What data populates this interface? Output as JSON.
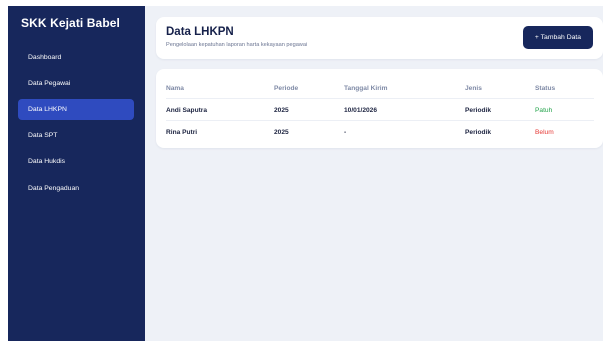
{
  "sidebar": {
    "brand": "SKK Kejati Babel",
    "items": [
      {
        "label": "Dashboard"
      },
      {
        "label": "Data Pegawai"
      },
      {
        "label": "Data LHKPN"
      },
      {
        "label": "Data SPT"
      },
      {
        "label": "Data Hukdis"
      },
      {
        "label": "Data Pengaduan"
      }
    ],
    "active_index": 2
  },
  "header": {
    "title": "Data LHKPN",
    "subtitle": "Pengelolaan kepatuhan laporan harta kekayaan pegawai",
    "add_button_label": "+ Tambah Data"
  },
  "table": {
    "columns": [
      "Nama",
      "Periode",
      "Tanggal Kirim",
      "Jenis",
      "Status"
    ],
    "rows": [
      {
        "nama": "Andi Saputra",
        "periode": "2025",
        "tanggal": "10/01/2026",
        "jenis": "Periodik",
        "status": "Patuh"
      },
      {
        "nama": "Rina Putri",
        "periode": "2025",
        "tanggal": "-",
        "jenis": "Periodik",
        "status": "Belum"
      }
    ]
  },
  "colors": {
    "sidebar_bg": "#17275c",
    "active_item": "#2f4bbf",
    "status_ok": "#22a34a",
    "status_bad": "#e53935"
  }
}
